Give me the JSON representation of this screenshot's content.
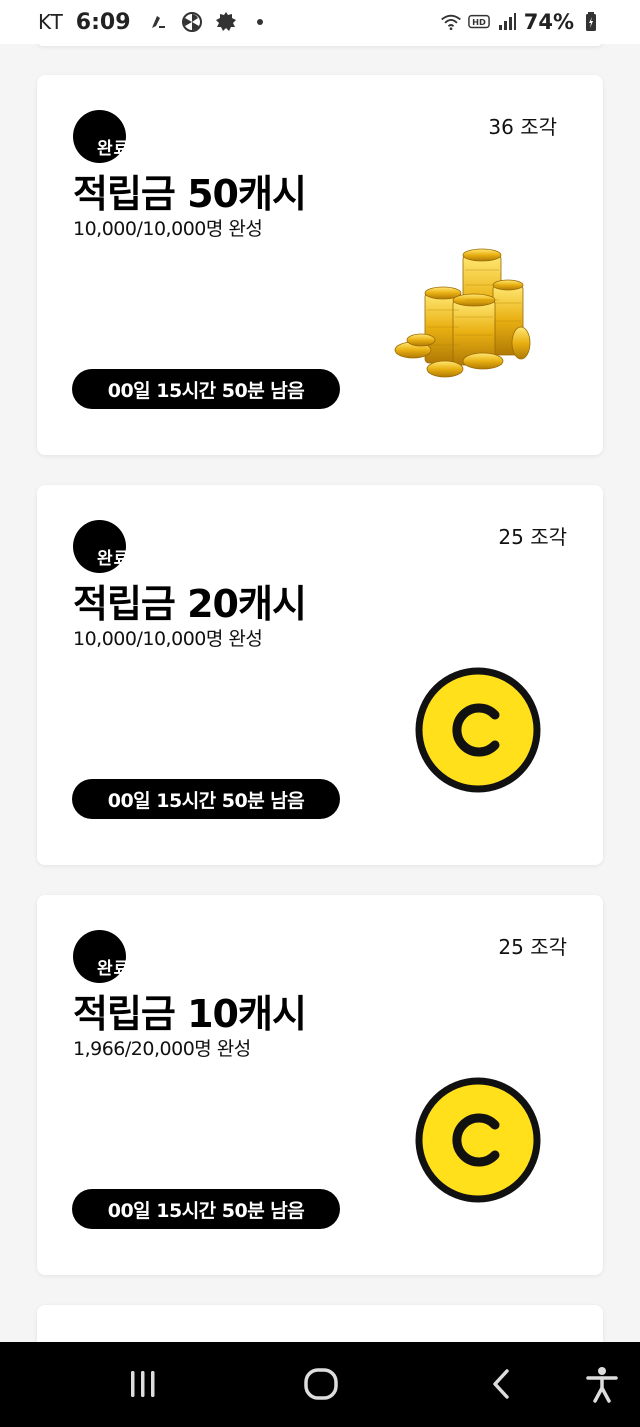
{
  "status_bar": {
    "carrier": "KT",
    "time": "6:09",
    "battery": "74%",
    "icons": [
      "app-notification-icon",
      "fan-icon",
      "settings-badge-icon",
      "wifi-icon",
      "hd-icon",
      "signal-icon",
      "battery-icon"
    ]
  },
  "cards": [
    {
      "badge": "완료",
      "pieces": "36 조각",
      "title": "적립금 50캐시",
      "subtitle": "10,000/10,000명 완성",
      "timer": "00일 15시간 50분 남음",
      "image": "gold-coins-stack"
    },
    {
      "badge": "완료",
      "pieces": "25 조각",
      "title": "적립금 20캐시",
      "subtitle": "10,000/10,000명 완성",
      "timer": "00일 15시간 50분 남음",
      "image": "c-coin"
    },
    {
      "badge": "완료",
      "pieces": "25 조각",
      "title": "적립금 10캐시",
      "subtitle": "1,966/20,000명 완성",
      "timer": "00일 15시간 50분 남음",
      "image": "c-coin"
    }
  ],
  "nav": {
    "buttons": [
      "recent-apps-icon",
      "home-icon",
      "back-icon",
      "accessibility-icon"
    ]
  },
  "colors": {
    "coin_yellow": "#FFE01A",
    "black": "#000000",
    "background": "#F5F5F5"
  }
}
